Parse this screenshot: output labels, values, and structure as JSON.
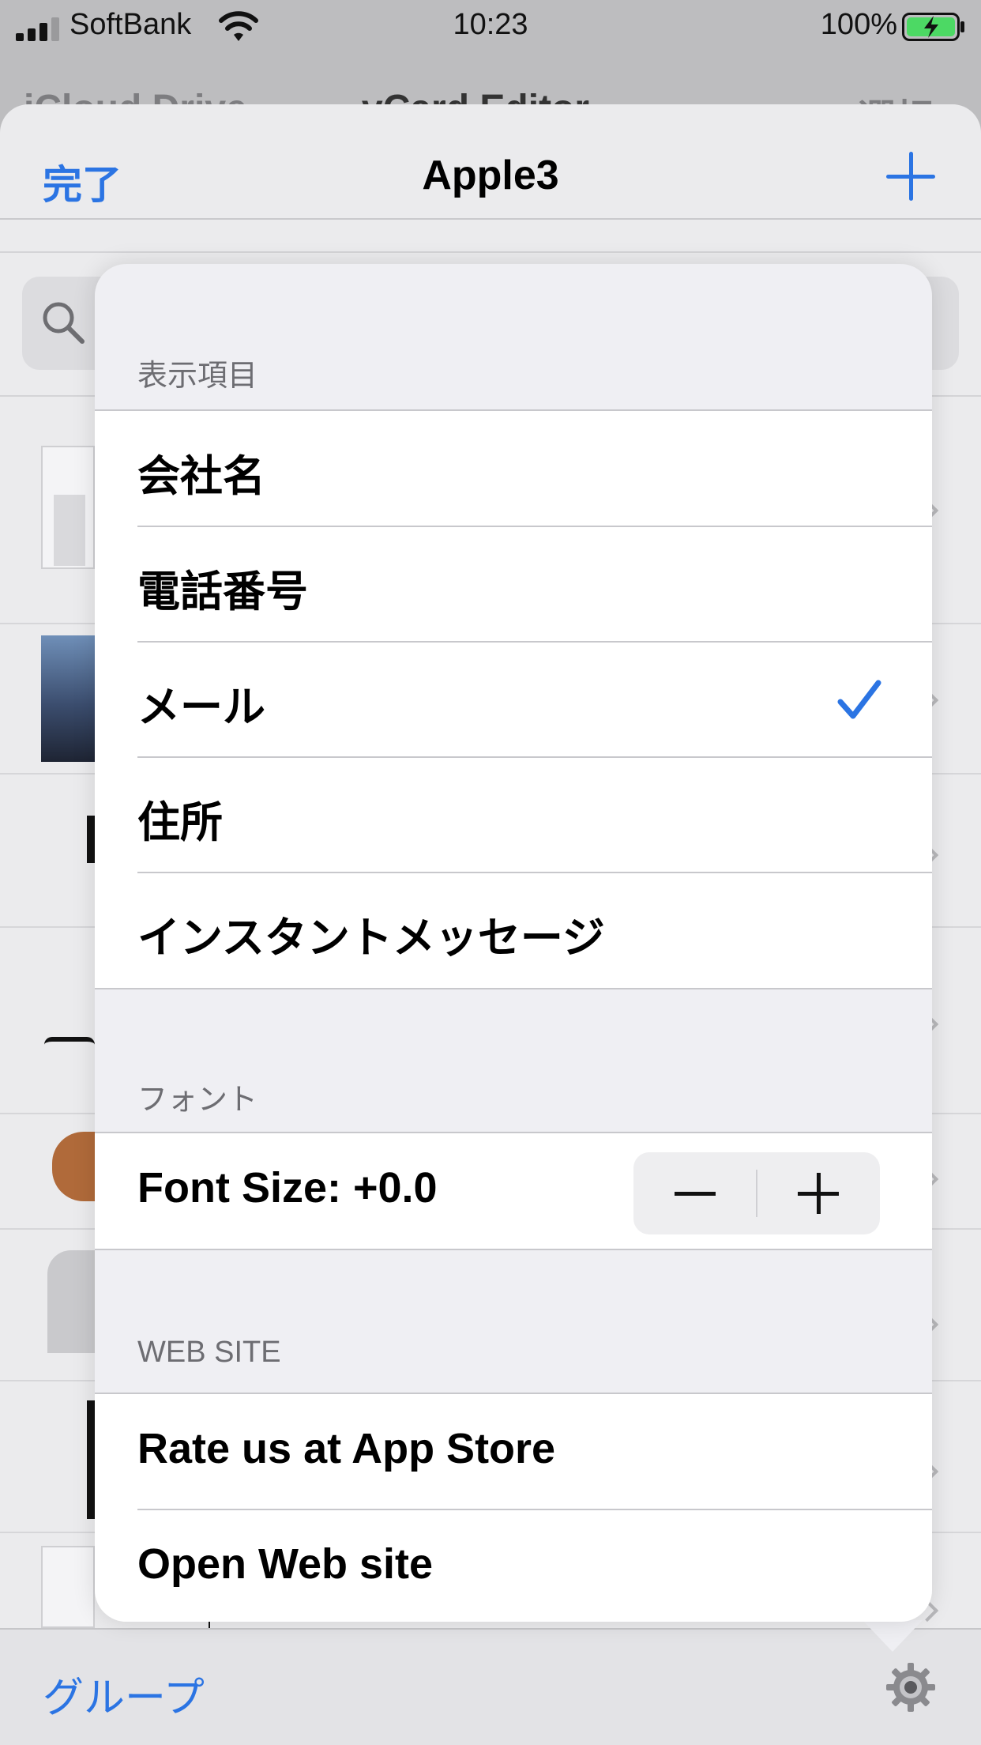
{
  "status_bar": {
    "carrier": "SoftBank",
    "time": "10:23",
    "battery": "100%"
  },
  "background_nav": {
    "back_label": "iCloud Drive",
    "title": "vCard Editor",
    "select_label": "選択"
  },
  "sheet": {
    "done_label": "完了",
    "title": "Apple3"
  },
  "popover": {
    "display_section": {
      "header": "表示項目",
      "items": [
        {
          "label": "会社名",
          "checked": false
        },
        {
          "label": "電話番号",
          "checked": false
        },
        {
          "label": "メール",
          "checked": true
        },
        {
          "label": "住所",
          "checked": false
        },
        {
          "label": "インスタントメッセージ",
          "checked": false
        }
      ]
    },
    "font_section": {
      "header": "フォント",
      "font_size_label": "Font Size: +0.0"
    },
    "website_section": {
      "header": "WEB SITE",
      "items": [
        {
          "label": "Rate us at App Store"
        },
        {
          "label": "Open Web site"
        }
      ]
    }
  },
  "toolbar": {
    "group_label": "グループ"
  },
  "colors": {
    "accent": "#2b74e3",
    "popover_bg": "#efeff3",
    "section_text": "#6d6d72"
  }
}
